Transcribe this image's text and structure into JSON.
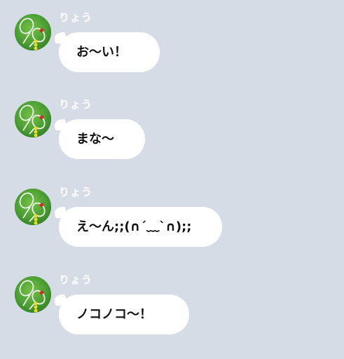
{
  "messages": [
    {
      "sender": "りょう",
      "text": "お～い！",
      "avatar_icon": "tennis-rackets-avatar-icon"
    },
    {
      "sender": "りょう",
      "text": "まな～",
      "avatar_icon": "tennis-rackets-avatar-icon"
    },
    {
      "sender": "りょう",
      "text": "え～ん;;(∩´﹏`∩);;",
      "avatar_icon": "tennis-rackets-avatar-icon"
    },
    {
      "sender": "りょう",
      "text": "ノコノコ～！",
      "avatar_icon": "tennis-rackets-avatar-icon"
    }
  ],
  "colors": {
    "background": "#d5dce5",
    "bubble": "#ffffff",
    "sender_text": "#ffffff",
    "message_text": "#111111",
    "avatar_grass": "#3f8f2d",
    "racket_frame": "#f1f1f1",
    "tennis_ball": "#f2df1b",
    "racket_string_accent": "#d72626"
  }
}
